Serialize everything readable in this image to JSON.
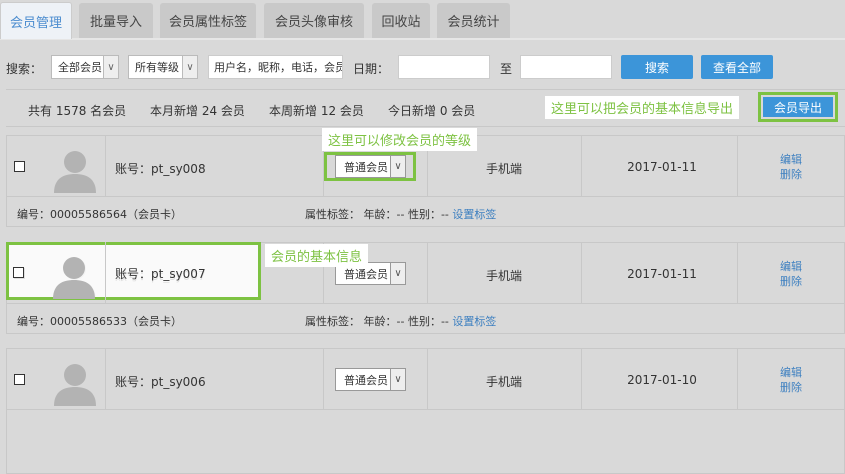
{
  "tabs": [
    {
      "label": "会员管理",
      "active": true
    },
    {
      "label": "批量导入",
      "active": false
    },
    {
      "label": "会员属性标签",
      "active": false
    },
    {
      "label": "会员头像审核",
      "active": false
    },
    {
      "label": "回收站",
      "active": false
    },
    {
      "label": "会员统计",
      "active": false
    }
  ],
  "search": {
    "label": "搜索：",
    "scope_value": "全部会员",
    "level_value": "所有等级",
    "keyword_placeholder": "用户名，昵称，电话，会员",
    "date_label": "日期：",
    "to_label": "至",
    "search_button": "搜索",
    "view_all_button": "查看全部"
  },
  "stats": {
    "total": "共有 1578 名会员",
    "month_new": "本月新增 24 会员",
    "week_new": "本周新增 12 会员",
    "today_new": "今日新增 0 会员"
  },
  "export": {
    "hint": "这里可以把会员的基本信息导出",
    "button": "会员导出"
  },
  "annotations": {
    "level_hint": "这里可以修改会员的等级",
    "info_hint": "会员的基本信息"
  },
  "members": [
    {
      "account": "账号：pt_sy008",
      "level": "普通会员",
      "device": "手机端",
      "date": "2017-01-11",
      "edit": "编辑",
      "delete": "删除",
      "number": "编号：00005586564（会员卡）",
      "tags_label": "属性标签：",
      "age": "年龄：--",
      "gender": "性别：--",
      "set_tags": "设置标签"
    },
    {
      "account": "账号：pt_sy007",
      "level": "普通会员",
      "device": "手机端",
      "date": "2017-01-11",
      "edit": "编辑",
      "delete": "删除",
      "number": "编号：00005586533（会员卡）",
      "tags_label": "属性标签：",
      "age": "年龄：--",
      "gender": "性别：--",
      "set_tags": "设置标签"
    },
    {
      "account": "账号：pt_sy006",
      "level": "普通会员",
      "device": "手机端",
      "date": "2017-01-10",
      "edit": "编辑",
      "delete": "删除"
    }
  ],
  "colors": {
    "accent": "#3c95d9",
    "highlight": "#7dc242",
    "link": "#3c7fc0"
  }
}
